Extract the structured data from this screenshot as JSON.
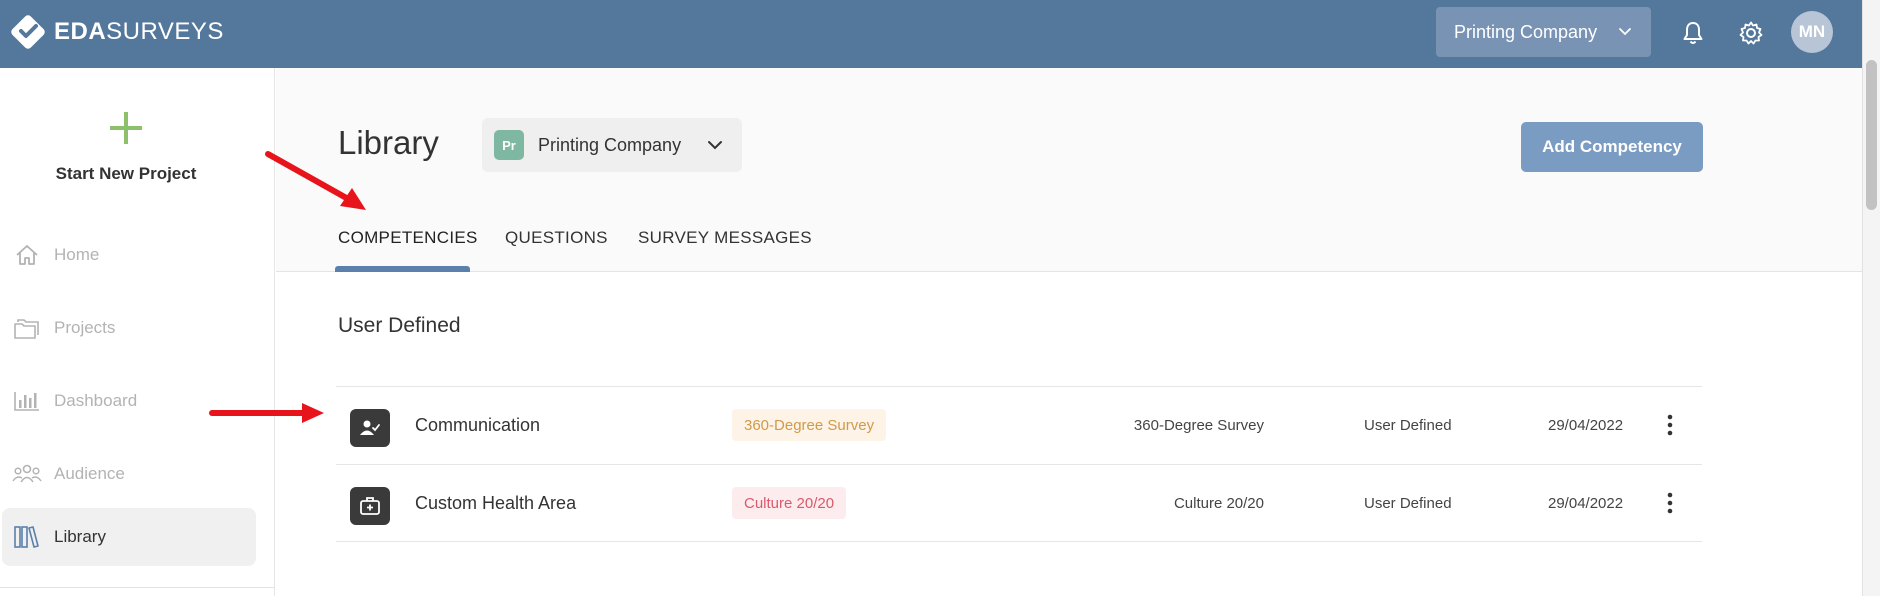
{
  "app": {
    "logo_bold": "EDA",
    "logo_light": "SURVEYS",
    "topbar_company": "Printing Company",
    "user_initials": "MN"
  },
  "sidebar": {
    "start_new_project": "Start New Project",
    "items": [
      {
        "label": "Home",
        "icon": "home-icon",
        "active": false
      },
      {
        "label": "Projects",
        "icon": "folder-icon",
        "active": false
      },
      {
        "label": "Dashboard",
        "icon": "bar-chart-icon",
        "active": false
      },
      {
        "label": "Audience",
        "icon": "people-icon",
        "active": false
      },
      {
        "label": "Library",
        "icon": "books-icon",
        "active": true
      }
    ]
  },
  "header": {
    "title": "Library",
    "org_badge": "Pr",
    "org_name": "Printing Company",
    "add_button": "Add Competency",
    "tabs": [
      {
        "label": "COMPETENCIES",
        "active": true
      },
      {
        "label": "QUESTIONS",
        "active": false
      },
      {
        "label": "SURVEY MESSAGES",
        "active": false
      }
    ]
  },
  "content": {
    "section_title": "User Defined",
    "rows": [
      {
        "icon": "person-check-icon",
        "name": "Communication",
        "tag": "360-Degree Survey",
        "tag_color": "orange",
        "type": "360-Degree Survey",
        "source": "User Defined",
        "date": "29/04/2022"
      },
      {
        "icon": "medical-kit-icon",
        "name": "Custom Health Area",
        "tag": "Culture 20/20",
        "tag_color": "red",
        "type": "Culture 20/20",
        "source": "User Defined",
        "date": "29/04/2022"
      }
    ]
  },
  "colors": {
    "topbar": "#54779c",
    "accent": "#7a9bc2",
    "plus": "#8dc06a",
    "annotation_arrow": "#e8141b"
  }
}
